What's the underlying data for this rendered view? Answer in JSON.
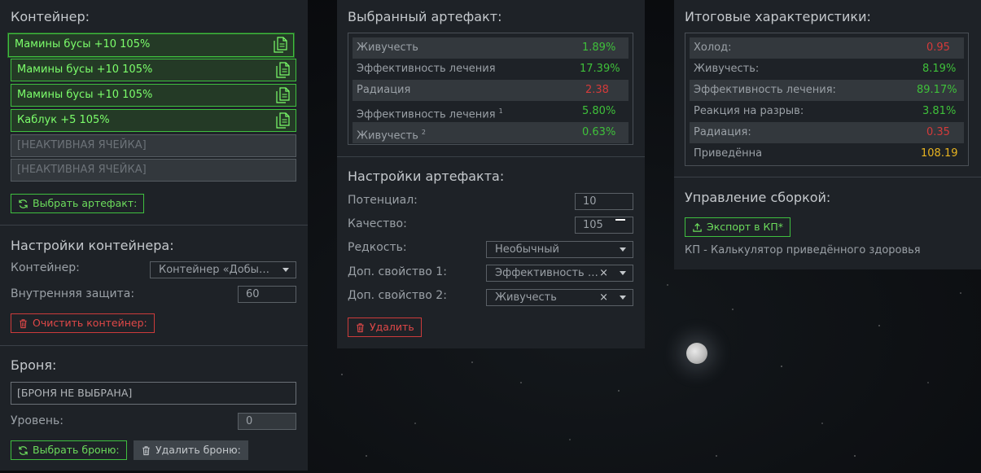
{
  "left": {
    "container_title": "Контейнер:",
    "slots": [
      {
        "label": "Мамины бусы +10 105%"
      },
      {
        "label": "Мамины бусы +10 105%"
      },
      {
        "label": "Мамины бусы +10 105%"
      },
      {
        "label": "Каблук +5 105%"
      }
    ],
    "inactive_slots": [
      "[НЕАКТИВНАЯ ЯЧЕЙКА]",
      "[НЕАКТИВНАЯ ЯЧЕЙКА]"
    ],
    "choose_artifact_label": "Выбрать артефакт:",
    "container_settings_title": "Настройки контейнера:",
    "container_label": "Контейнер:",
    "container_value": "Контейнер «Добытч...",
    "internal_protection_label": "Внутренняя защита:",
    "internal_protection_value": "60",
    "clear_container_label": "Очистить контейнер:",
    "armor_title": "Броня:",
    "armor_value": "[БРОНЯ НЕ ВЫБРАНА]",
    "level_label": "Уровень:",
    "level_value": "0",
    "choose_armor_label": "Выбрать броню:",
    "delete_armor_label": "Удалить броню:"
  },
  "mid": {
    "selected_title": "Выбранный артефакт:",
    "stats": [
      {
        "name": "Живучесть",
        "value": "1.89%",
        "color": "green",
        "sup": ""
      },
      {
        "name": "Эффективность лечения",
        "value": "17.39%",
        "color": "green",
        "sup": ""
      },
      {
        "name": "Радиация",
        "value": "2.38",
        "color": "red",
        "sup": ""
      },
      {
        "name": "Эффективность лечения",
        "value": "5.80%",
        "color": "green",
        "sup": "1"
      },
      {
        "name": "Живучесть",
        "value": "0.63%",
        "color": "green",
        "sup": "2"
      }
    ],
    "settings_title": "Настройки артефакта:",
    "potential_label": "Потенциал:",
    "potential_value": "10",
    "quality_label": "Качество:",
    "quality_value": "105",
    "rarity_label": "Редкость:",
    "rarity_value": "Необычный",
    "prop1_label": "Доп. свойство 1:",
    "prop1_value": "Эффективность ле...",
    "prop2_label": "Доп. свойство 2:",
    "prop2_value": "Живучесть",
    "clear_symbol": "×",
    "delete_label": "Удалить"
  },
  "right": {
    "total_title": "Итоговые характеристики:",
    "stats": [
      {
        "name": "Холод:",
        "value": "0.95",
        "color": "red"
      },
      {
        "name": "Живучесть:",
        "value": "8.19%",
        "color": "green"
      },
      {
        "name": "Эффективность лечения:",
        "value": "89.17%",
        "color": "green"
      },
      {
        "name": "Реакция на разрыв:",
        "value": "3.81%",
        "color": "green"
      },
      {
        "name": "Радиация:",
        "value": "0.35",
        "color": "red"
      },
      {
        "name": "Приведённа",
        "value": "108.19",
        "color": "yellow"
      }
    ],
    "build_title": "Управление сборкой:",
    "export_label": "Экспорт в КП*",
    "caption": "КП - Калькулятор приведённого здоровья"
  },
  "colors": {
    "accent_green": "#3fbf3f",
    "danger_red": "#cc3b3b",
    "highlight_yellow": "#e8b420",
    "panel_bg": "#1e2227"
  }
}
